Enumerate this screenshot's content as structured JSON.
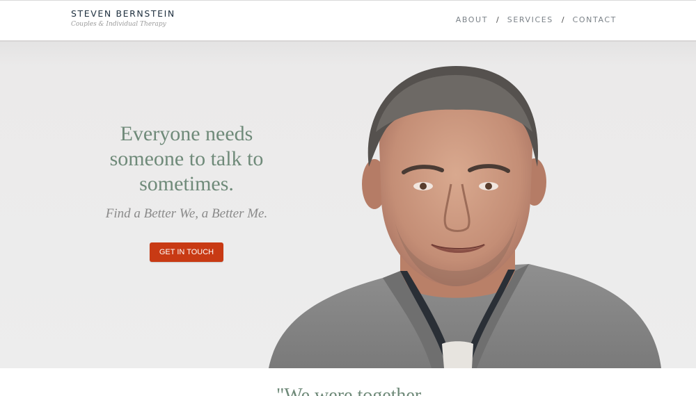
{
  "header": {
    "brand_name": "STEVEN BERNSTEIN",
    "tagline": "Couples & Individual Therapy",
    "nav": [
      {
        "label": "ABOUT"
      },
      {
        "label": "SERVICES"
      },
      {
        "label": "CONTACT"
      }
    ],
    "separator": "/"
  },
  "hero": {
    "heading_line1": "Everyone needs",
    "heading_line2": "someone to talk to",
    "heading_line3": "sometimes.",
    "subheading": "Find a Better We, a Better Me.",
    "cta_label": "GET IN TOUCH"
  },
  "quote": {
    "text": "\"We were together"
  },
  "colors": {
    "accent": "#c83a14",
    "heading": "#6f8a79",
    "nav": "#7b8288",
    "brand": "#1e2f3e",
    "hero_bg": "#ececec"
  },
  "icons": {
    "portrait": "portrait-photo"
  }
}
